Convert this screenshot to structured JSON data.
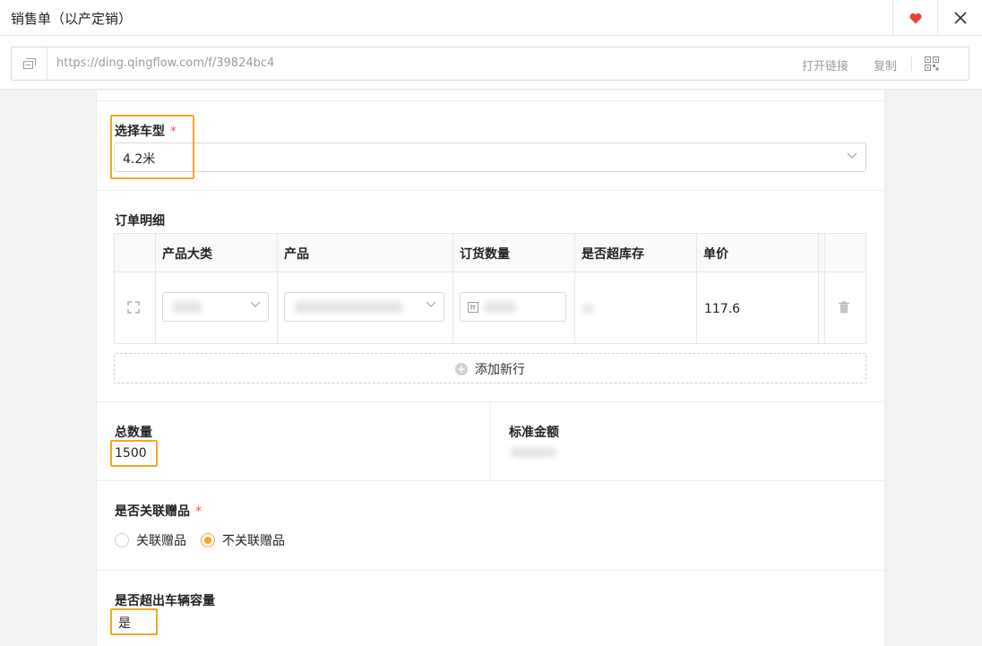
{
  "window": {
    "title": "销售单（以产定销）"
  },
  "url_bar": {
    "url": "https://ding.qingflow.com/f/39824bc4",
    "open_link_label": "打开链接",
    "copy_label": "复制"
  },
  "form": {
    "vehicle_type": {
      "label": "选择车型",
      "required_mark": "*",
      "value": "4.2米"
    },
    "order_details": {
      "label": "订单明细",
      "columns": [
        "产品大类",
        "产品",
        "订货数量",
        "是否超库存",
        "单价"
      ],
      "rows": [
        {
          "unit_price": "117.6"
        }
      ],
      "add_row_label": "添加新行"
    },
    "total_quantity": {
      "label": "总数量",
      "value": "1500"
    },
    "standard_amount": {
      "label": "标准金额"
    },
    "gift_link": {
      "label": "是否关联赠品",
      "required_mark": "*",
      "options": [
        "关联赠品",
        "不关联赠品"
      ],
      "selected": "不关联赠品"
    },
    "over_capacity": {
      "label": "是否超出车辆容量",
      "value": "是"
    }
  },
  "colors": {
    "accent": "#f5a623",
    "heart": "#e8432e",
    "required": "#ff4d4f"
  }
}
